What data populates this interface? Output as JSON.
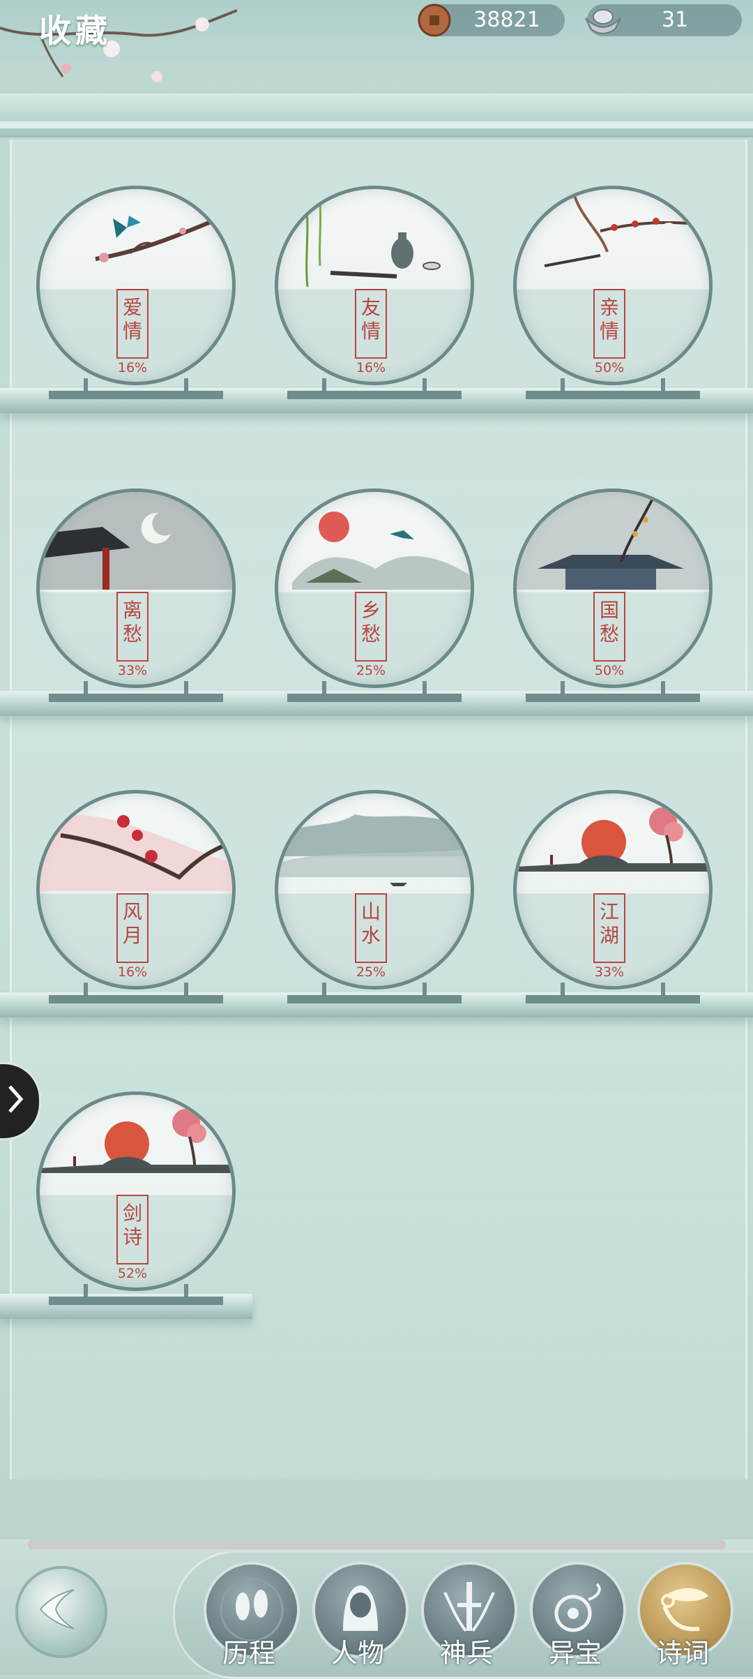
{
  "header": {
    "title": "收藏",
    "coins": {
      "icon": "copper-coin-icon",
      "value": "38821"
    },
    "silver": {
      "icon": "silver-ingot-icon",
      "value": "31"
    }
  },
  "collections": [
    {
      "chars": [
        "爱",
        "情"
      ],
      "percent": "16%",
      "scene": "butterfly-branch"
    },
    {
      "chars": [
        "友",
        "情"
      ],
      "percent": "16%",
      "scene": "willow-wine"
    },
    {
      "chars": [
        "亲",
        "情"
      ],
      "percent": "50%",
      "scene": "plum-swing"
    },
    {
      "chars": [
        "离",
        "愁"
      ],
      "percent": "33%",
      "scene": "snow-moon-eave"
    },
    {
      "chars": [
        "乡",
        "愁"
      ],
      "percent": "25%",
      "scene": "sun-mountain-bird"
    },
    {
      "chars": [
        "国",
        "愁"
      ],
      "percent": "50%",
      "scene": "rain-palace"
    },
    {
      "chars": [
        "风",
        "月"
      ],
      "percent": "16%",
      "scene": "red-plum"
    },
    {
      "chars": [
        "山",
        "水"
      ],
      "percent": "25%",
      "scene": "misty-mountain"
    },
    {
      "chars": [
        "江",
        "湖"
      ],
      "percent": "33%",
      "scene": "sunset-bridge"
    },
    {
      "chars": [
        "剑",
        "诗"
      ],
      "percent": "52%",
      "scene": "sunset-bridge"
    }
  ],
  "side_panel": {
    "icon": "chevron-right-icon"
  },
  "back_button": {
    "icon": "back-arrow-icon"
  },
  "nav": [
    {
      "label": "历程",
      "icon": "footprints-icon",
      "active": false
    },
    {
      "label": "人物",
      "icon": "character-icon",
      "active": false
    },
    {
      "label": "神兵",
      "icon": "sword-icon",
      "active": false
    },
    {
      "label": "异宝",
      "icon": "treasure-icon",
      "active": false
    },
    {
      "label": "诗词",
      "icon": "scroll-icon",
      "active": true
    }
  ],
  "colors": {
    "seal_red": "#b8453f",
    "frame": "#6c8a88",
    "active_gold": "#c9a866"
  }
}
